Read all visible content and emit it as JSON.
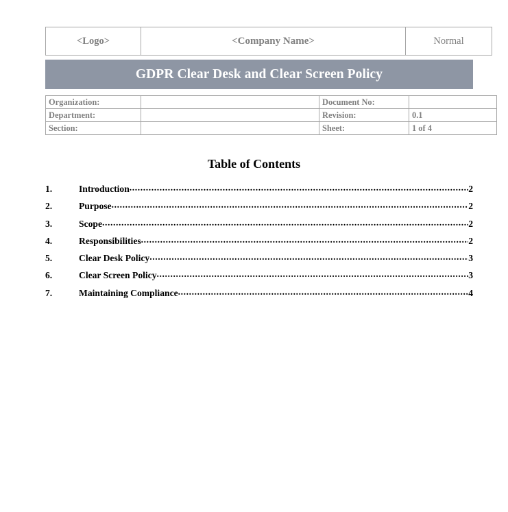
{
  "document": {
    "header": {
      "logo_placeholder": "<Logo>",
      "company_placeholder": "<Company Name>",
      "classification": "Normal"
    },
    "title_banner": {
      "title": "GDPR Clear Desk and Clear Screen Policy",
      "background_color": "#8e96a4",
      "text_color": "#ffffff"
    },
    "metadata": {
      "rows": [
        {
          "label": "Organization:",
          "value": "",
          "label2": "Document No:",
          "value2": ""
        },
        {
          "label": "Department:",
          "value": "",
          "label2": "Revision:",
          "value2": "0.1"
        },
        {
          "label": "Section:",
          "value": "",
          "label2": "Sheet:",
          "value2": "1 of 4"
        }
      ]
    },
    "toc": {
      "heading": "Table of Contents",
      "entries": [
        {
          "number": "1.",
          "label": "Introduction",
          "page": "2"
        },
        {
          "number": "2.",
          "label": "Purpose ",
          "page": "2"
        },
        {
          "number": "3.",
          "label": "Scope ",
          "page": "2"
        },
        {
          "number": "4.",
          "label": "Responsibilities ",
          "page": "2"
        },
        {
          "number": "5.",
          "label": "Clear Desk Policy",
          "page": "3"
        },
        {
          "number": "6.",
          "label": "Clear Screen Policy ",
          "page": "3"
        },
        {
          "number": "7.",
          "label": "Maintaining Compliance",
          "page": "4"
        }
      ]
    }
  }
}
